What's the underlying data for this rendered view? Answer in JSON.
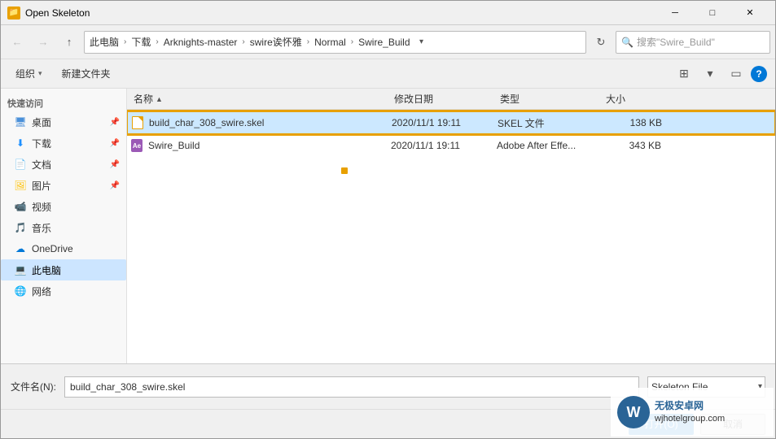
{
  "window": {
    "title": "Open Skeleton",
    "close_label": "✕",
    "minimize_label": "─",
    "maximize_label": "□"
  },
  "toolbar": {
    "back_disabled": true,
    "forward_disabled": true,
    "up_label": "↑",
    "search_placeholder": "搜索\"Swire_Build\"",
    "breadcrumbs": [
      {
        "label": "此电脑"
      },
      {
        "label": "下载"
      },
      {
        "label": "Arknights-master"
      },
      {
        "label": "swire诶怀雅"
      },
      {
        "label": "Normal"
      },
      {
        "label": "Swire_Build"
      }
    ]
  },
  "action_bar": {
    "organize_label": "组织",
    "new_folder_label": "新建文件夹"
  },
  "sidebar": {
    "quick_access_label": "快速访问",
    "items": [
      {
        "id": "desktop",
        "label": "桌面",
        "icon": "desktop",
        "pinned": true
      },
      {
        "id": "downloads",
        "label": "下载",
        "icon": "downloads",
        "pinned": true
      },
      {
        "id": "documents",
        "label": "文档",
        "icon": "documents",
        "pinned": true
      },
      {
        "id": "pictures",
        "label": "图片",
        "icon": "pictures",
        "pinned": true
      },
      {
        "id": "videos",
        "label": "视频",
        "icon": "videos",
        "pinned": false
      },
      {
        "id": "music",
        "label": "音乐",
        "icon": "music",
        "pinned": false
      },
      {
        "id": "onedrive",
        "label": "OneDrive",
        "icon": "onedrive",
        "pinned": false
      },
      {
        "id": "thispc",
        "label": "此电脑",
        "icon": "thispc",
        "active": true
      },
      {
        "id": "network",
        "label": "网络",
        "icon": "network",
        "pinned": false
      }
    ]
  },
  "file_list": {
    "columns": [
      {
        "id": "name",
        "label": "名称",
        "sort": "asc"
      },
      {
        "id": "date",
        "label": "修改日期"
      },
      {
        "id": "type",
        "label": "类型"
      },
      {
        "id": "size",
        "label": "大小"
      }
    ],
    "files": [
      {
        "id": "skel-file",
        "name": "build_char_308_swire.skel",
        "date": "2020/11/1 19:11",
        "type": "SKEL 文件",
        "size": "138 KB",
        "icon_type": "skel",
        "selected": true
      },
      {
        "id": "ae-file",
        "name": "Swire_Build",
        "date": "2020/11/1 19:11",
        "type": "Adobe After Effe...",
        "size": "343 KB",
        "icon_type": "ae",
        "selected": false
      }
    ]
  },
  "bottom_bar": {
    "filename_label": "文件名(N):",
    "filename_value": "build_char_308_swire.skel",
    "filetype_label": "Skeleton File",
    "open_label": "打开(O)",
    "cancel_label": "取消"
  },
  "watermark": {
    "logo": "W",
    "line1": "无极安卓网",
    "line2": "wjhotelgroup.com"
  }
}
